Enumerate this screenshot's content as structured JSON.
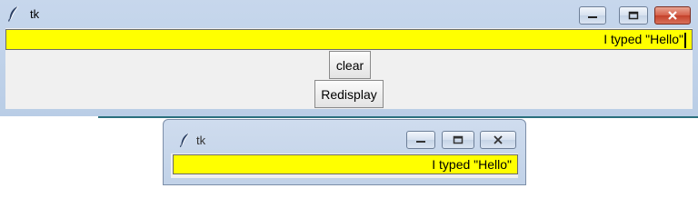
{
  "main_window": {
    "title": "tk",
    "entry_text": "I typed \"Hello\"",
    "clear_label": "clear",
    "redisplay_label": "Redisplay"
  },
  "popup_window": {
    "title": "tk",
    "entry_text": "I typed \"Hello\""
  },
  "colors": {
    "entry_background": "#ffff00",
    "close_button_active": "#c4412a"
  },
  "icons": {
    "app_icon": "feather-icon",
    "minimize": "minimize-icon",
    "maximize": "maximize-icon",
    "close": "close-icon"
  }
}
